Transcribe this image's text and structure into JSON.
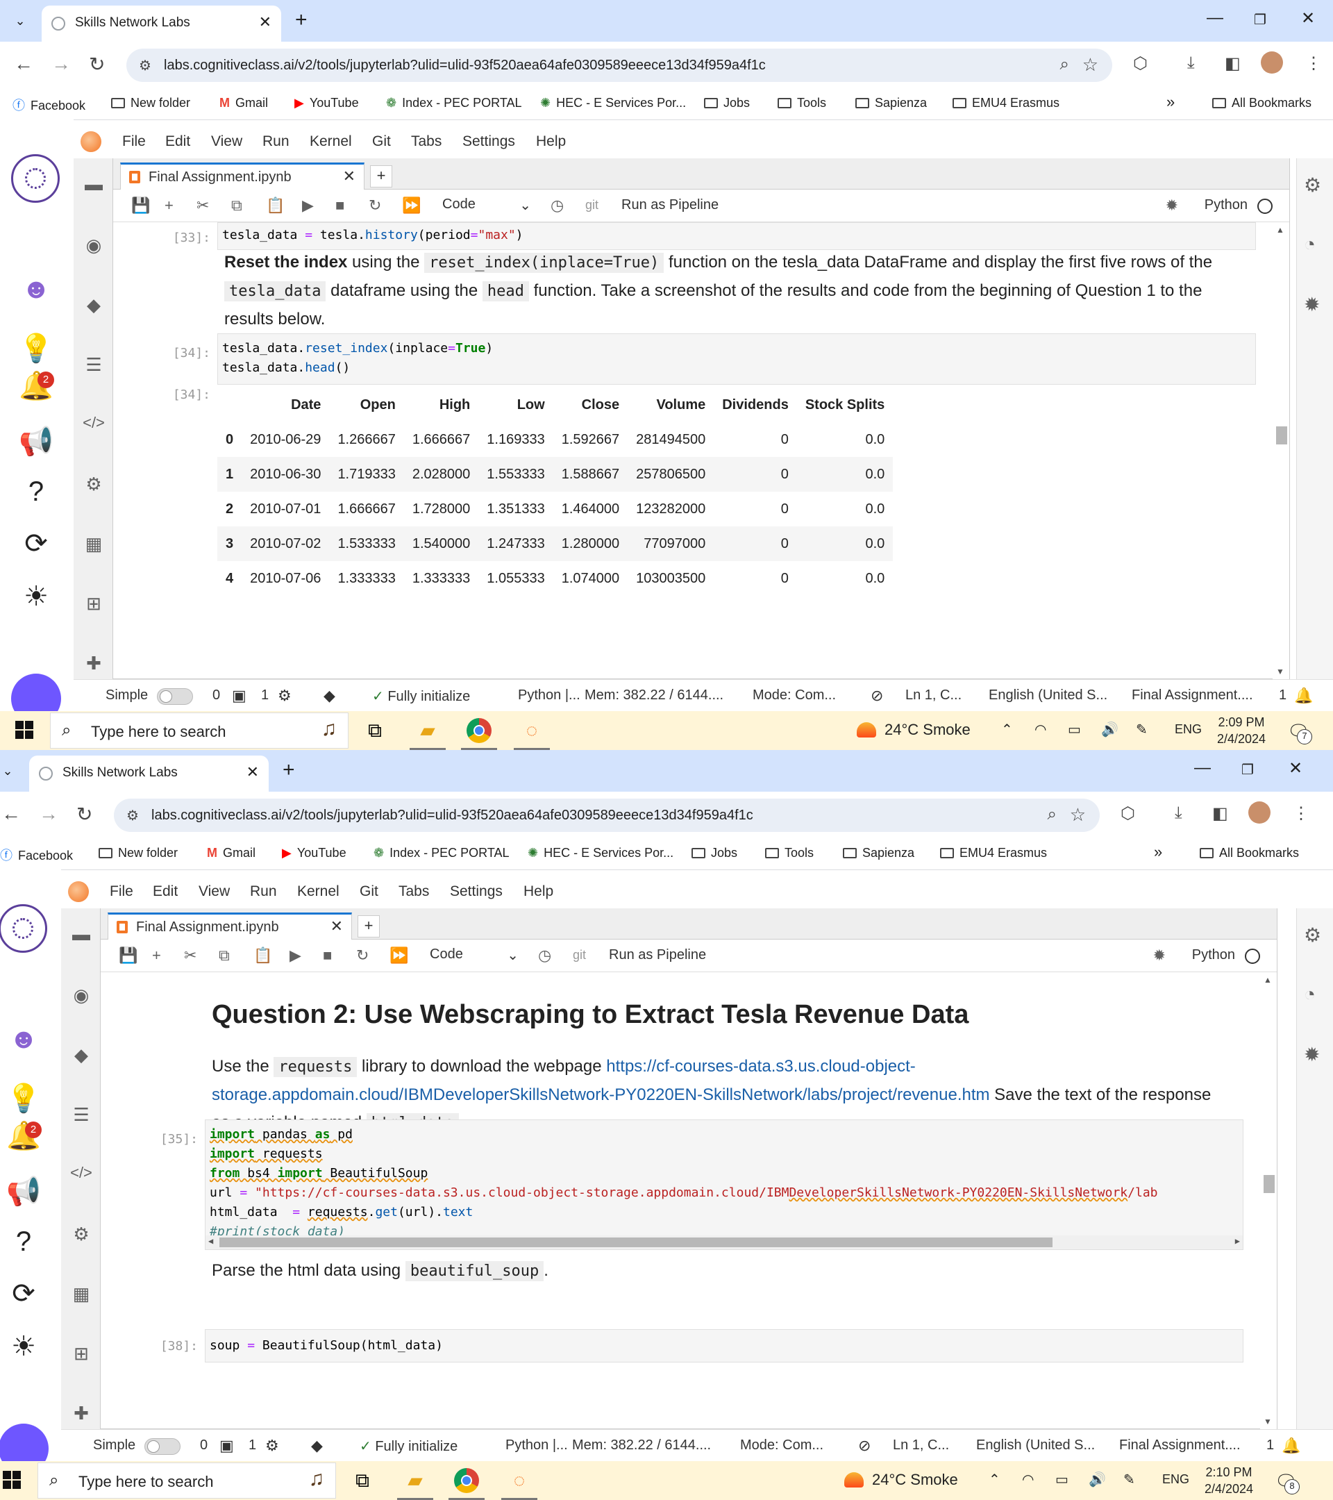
{
  "browser": {
    "tab_title": "Skills Network Labs",
    "url": "labs.cognitiveclass.ai/v2/tools/jupyterlab?ulid=ulid-93f520aea64afe0309589eeece13d34f959a4f1c",
    "bookmarks": [
      "Facebook",
      "New folder",
      "Gmail",
      "YouTube",
      "Index - PEC PORTAL",
      "HEC - E Services Por...",
      "Jobs",
      "Tools",
      "Sapienza",
      "EMU4 Erasmus"
    ],
    "overflow": "»",
    "all_bookmarks": "All Bookmarks"
  },
  "jupyter": {
    "menu": [
      "File",
      "Edit",
      "View",
      "Run",
      "Kernel",
      "Git",
      "Tabs",
      "Settings",
      "Help"
    ],
    "tab_title": "Final Assignment.ipynb",
    "cell_type": "Code",
    "git": "git",
    "run_pipeline": "Run as Pipeline",
    "kernel": "Python",
    "notification_count": "2"
  },
  "shot1": {
    "p33": "[33]:",
    "p34": "[34]:",
    "p34o": "[34]:",
    "md": {
      "b": "Reset the index",
      "t1": " using the ",
      "c1": "reset_index(inplace=True)",
      "t2": " function on the tesla_data DataFrame and display the first five rows of the ",
      "c2": "tesla_data",
      "t3": " dataframe using the ",
      "c3": "head",
      "t4": " function. Take a screenshot of the results and code from the beginning of Question 1 to the results below."
    },
    "table": {
      "headers": [
        "",
        "Date",
        "Open",
        "High",
        "Low",
        "Close",
        "Volume",
        "Dividends",
        "Stock Splits"
      ],
      "rows": [
        [
          "0",
          "2010-06-29",
          "1.266667",
          "1.666667",
          "1.169333",
          "1.592667",
          "281494500",
          "0",
          "0.0"
        ],
        [
          "1",
          "2010-06-30",
          "1.719333",
          "2.028000",
          "1.553333",
          "1.588667",
          "257806500",
          "0",
          "0.0"
        ],
        [
          "2",
          "2010-07-01",
          "1.666667",
          "1.728000",
          "1.351333",
          "1.464000",
          "123282000",
          "0",
          "0.0"
        ],
        [
          "3",
          "2010-07-02",
          "1.533333",
          "1.540000",
          "1.247333",
          "1.280000",
          "77097000",
          "0",
          "0.0"
        ],
        [
          "4",
          "2010-07-06",
          "1.333333",
          "1.333333",
          "1.055333",
          "1.074000",
          "103003500",
          "0",
          "0.0"
        ]
      ]
    },
    "time": "2:09 PM",
    "notif": "7"
  },
  "shot2": {
    "heading": "Question 2: Use Webscraping to Extract Tesla Revenue Data",
    "md1": {
      "t1": "Use the ",
      "c1": "requests",
      "t2": " library to download the webpage ",
      "link": "https://cf-courses-data.s3.us.cloud-object-storage.appdomain.cloud/IBMDeveloperSkillsNetwork-PY0220EN-SkillsNetwork/labs/project/revenue.htm",
      "t3": " Save the text of the response as a variable named ",
      "c2": "html_data",
      "t4": "."
    },
    "p35": "[35]:",
    "p38": "[38]:",
    "md2": {
      "t1": "Parse the html data using ",
      "c1": "beautiful_soup",
      "t2": "."
    },
    "time": "2:10 PM",
    "notif": "8"
  },
  "status": {
    "simple": "Simple",
    "zero": "0",
    "one": "1",
    "init": "Fully initialize",
    "python": "Python |...",
    "mem": "Mem: 382.22 / 6144....",
    "mode": "Mode: Com...",
    "ln": "Ln 1, C...",
    "lang": "English (United S...",
    "file": "Final Assignment....",
    "count": "1"
  },
  "taskbar": {
    "search": "Type here to search",
    "weather": "24°C  Smoke",
    "lang": "ENG",
    "date": "2/4/2024"
  }
}
